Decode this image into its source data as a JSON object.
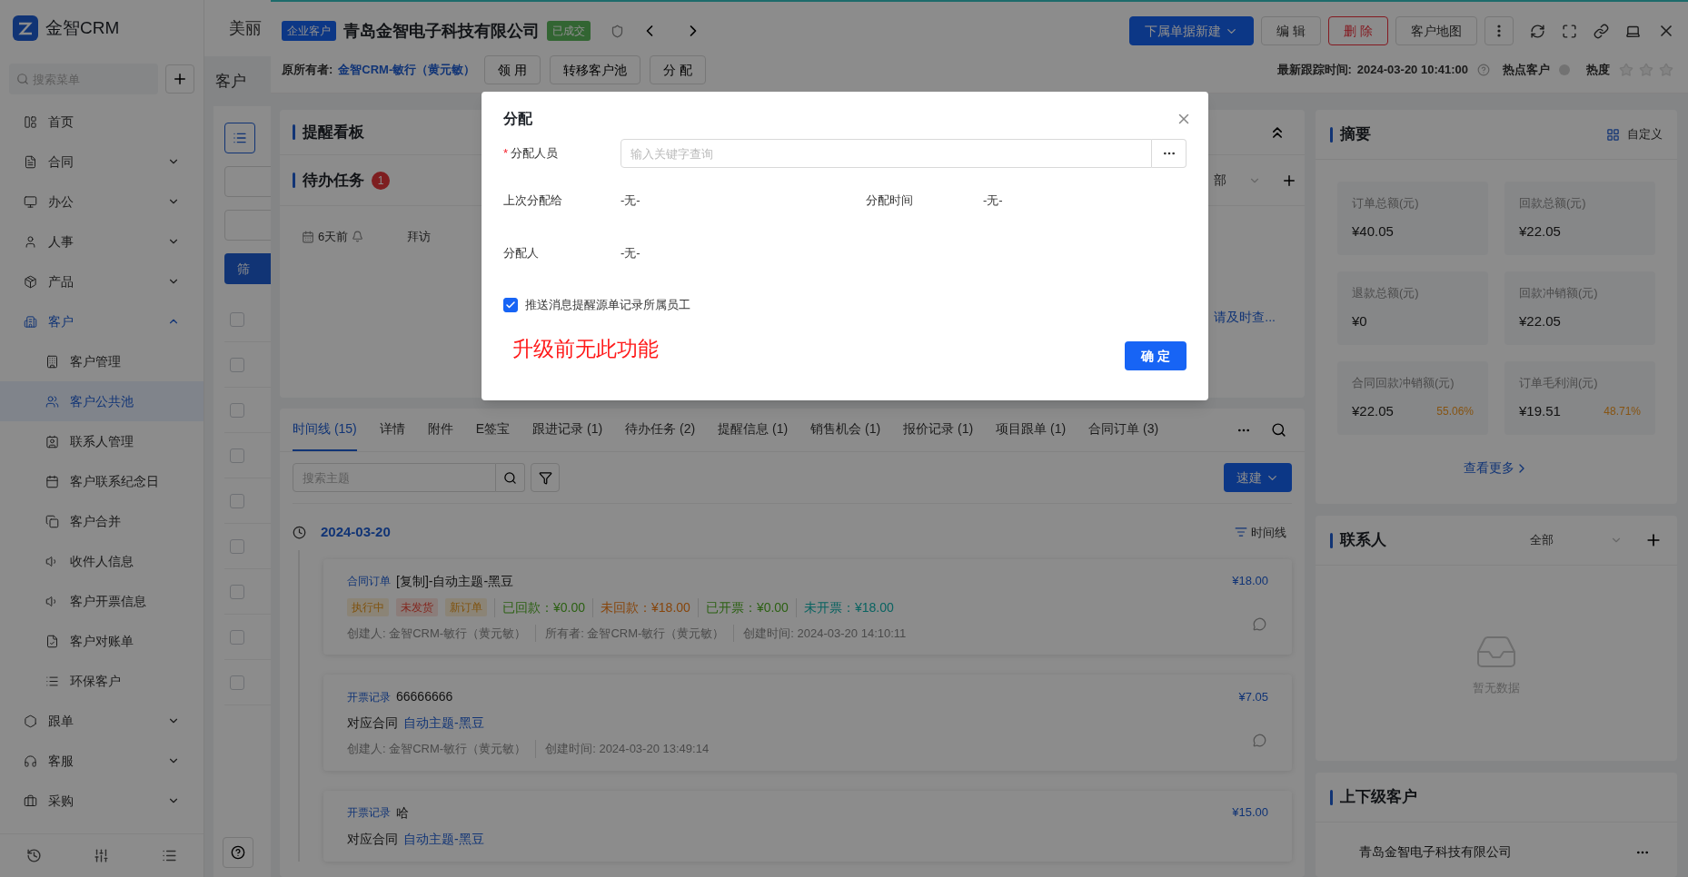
{
  "sidebar": {
    "logo_text": "金智CRM",
    "search": {
      "placeholder": "搜索菜单"
    },
    "items": [
      {
        "kind": "link",
        "label": "首页",
        "selected": false
      },
      {
        "kind": "group",
        "label": "合同",
        "expanded": false,
        "selected": false
      },
      {
        "kind": "group",
        "label": "办公",
        "expanded": false,
        "selected": false
      },
      {
        "kind": "group",
        "label": "人事",
        "expanded": false,
        "selected": false
      },
      {
        "kind": "group",
        "label": "产品",
        "expanded": false,
        "selected": false
      },
      {
        "kind": "group",
        "label": "客户",
        "expanded": true,
        "selected": true,
        "children": [
          {
            "label": "客户管理",
            "selected": false
          },
          {
            "label": "客户公共池",
            "selected": true
          },
          {
            "label": "联系人管理",
            "selected": false
          },
          {
            "label": "客户联系纪念日",
            "selected": false
          },
          {
            "label": "客户合并",
            "selected": false
          },
          {
            "label": "收件人信息",
            "selected": false
          },
          {
            "label": "客户开票信息",
            "selected": false
          },
          {
            "label": "客户对账单",
            "selected": false
          },
          {
            "label": "环保客户",
            "selected": false
          }
        ]
      },
      {
        "kind": "group",
        "label": "跟单",
        "expanded": false,
        "selected": false
      },
      {
        "kind": "group",
        "label": "客服",
        "expanded": false,
        "selected": false
      },
      {
        "kind": "group",
        "label": "采购",
        "expanded": false,
        "selected": false
      }
    ]
  },
  "background_page": {
    "title": "美丽",
    "subtitle": "客户",
    "filter_button": "筛",
    "rows": [
      {
        "checked": false
      },
      {
        "checked": false
      },
      {
        "checked": false
      },
      {
        "checked": false
      },
      {
        "checked": false
      },
      {
        "checked": false
      },
      {
        "checked": false
      },
      {
        "checked": false
      },
      {
        "checked": false
      }
    ]
  },
  "header": {
    "type_badge": "企业客户",
    "title": "青岛金智电子科技有限公司",
    "status_badge": "已成交",
    "actions": [
      {
        "label": "下属单据新建",
        "kind": "primary"
      },
      {
        "label": "编 辑",
        "kind": "default"
      },
      {
        "label": "删 除",
        "kind": "danger"
      },
      {
        "label": "客户地图",
        "kind": "default"
      }
    ],
    "owner_label": "原所有者:",
    "owner": "金智CRM-敏行（黄元敏）",
    "owner_actions": [
      "领 用",
      "转移客户池",
      "分 配"
    ],
    "last_track_label": "最新跟踪时间:",
    "last_track_time": "2024-03-20 10:41:00",
    "hot_label": "热点客户",
    "hot": false,
    "heat_label": "热度",
    "heat": {
      "stars": 0
    }
  },
  "reminder": {
    "title": "提醒看板",
    "tasks_title": "待办任务",
    "tasks_count": "1",
    "filter_text": "部",
    "task": {
      "time": "6天前",
      "subject": "拜访"
    },
    "link": "请及时查..."
  },
  "tabs": [
    {
      "label": "时间线 (15)",
      "selected": true
    },
    {
      "label": "详情",
      "selected": false
    },
    {
      "label": "附件",
      "selected": false
    },
    {
      "label": "E签宝",
      "selected": false
    },
    {
      "label": "跟进记录 (1)",
      "selected": false
    },
    {
      "label": "待办任务 (2)",
      "selected": false
    },
    {
      "label": "提醒信息 (1)",
      "selected": false
    },
    {
      "label": "销售机会 (1)",
      "selected": false
    },
    {
      "label": "报价记录 (1)",
      "selected": false
    },
    {
      "label": "项目跟单 (1)",
      "selected": false
    },
    {
      "label": "合同订单 (3)",
      "selected": false
    }
  ],
  "timeline": {
    "search": {
      "placeholder": "搜索主题"
    },
    "quick_create": "速建",
    "date": "2024-03-20",
    "view_toggle": "时间线",
    "entries": [
      {
        "kind": "order",
        "type": "合同订单",
        "title": "[复制]-自动主题-黑豆",
        "amount": "¥18.00",
        "tags": [
          {
            "label": "执行中",
            "kind": "warning"
          },
          {
            "label": "未发货",
            "kind": "danger"
          },
          {
            "label": "新订单",
            "kind": "warning"
          }
        ],
        "stats": [
          {
            "text": "已回款：¥0.00",
            "kind": "done"
          },
          {
            "text": "未回款：¥18.00",
            "kind": "pending"
          },
          {
            "text": "已开票：¥0.00",
            "kind": "done"
          },
          {
            "text": "未开票：¥18.00",
            "kind": "open"
          }
        ],
        "meta": [
          "创建人: 金智CRM-敏行（黄元敏）",
          "所有者: 金智CRM-敏行（黄元敏）",
          "创建时间: 2024-03-20 14:10:11"
        ]
      },
      {
        "kind": "invoice",
        "type": "开票记录",
        "title": "66666666",
        "amount": "¥7.05",
        "contract_label": "对应合同",
        "contract": "自动主题-黑豆",
        "meta": [
          "创建人: 金智CRM-敏行（黄元敏）",
          "创建时间: 2024-03-20 13:49:14"
        ]
      },
      {
        "kind": "invoice",
        "type": "开票记录",
        "title": "哈",
        "amount": "¥15.00",
        "contract_label": "对应合同",
        "contract": "自动主题-黑豆"
      }
    ]
  },
  "summary": {
    "title": "摘要",
    "customize": "自定义",
    "stats": [
      {
        "label": "订单总额(元)",
        "value": "¥40.05"
      },
      {
        "label": "回款总额(元)",
        "value": "¥22.05"
      },
      {
        "label": "退款总额(元)",
        "value": "¥0"
      },
      {
        "label": "回款冲销额(元)",
        "value": "¥22.05"
      },
      {
        "label": "合同回款冲销额(元)",
        "value": "¥22.05",
        "ratio": "55.06%"
      },
      {
        "label": "订单毛利润(元)",
        "value": "¥19.51",
        "ratio": "48.71%"
      }
    ],
    "more": "查看更多"
  },
  "contacts": {
    "title": "联系人",
    "filter": "全部",
    "empty": "暂无数据"
  },
  "related": {
    "title": "上下级客户",
    "items": [
      "青岛金智电子科技有限公司"
    ]
  },
  "modal": {
    "title": "分配",
    "assignee_label": "分配人员",
    "required_mark": "*",
    "placeholder": "输入关键字查询",
    "info": [
      {
        "label": "上次分配给",
        "value": "-无-"
      },
      {
        "label": "分配时间",
        "value": "-无-"
      },
      {
        "label": "分配人",
        "value": "-无-"
      }
    ],
    "notify": {
      "label": "推送消息提醒源单记录所属员工",
      "checked": true
    },
    "note": "升级前无此功能",
    "confirm": "确 定"
  }
}
